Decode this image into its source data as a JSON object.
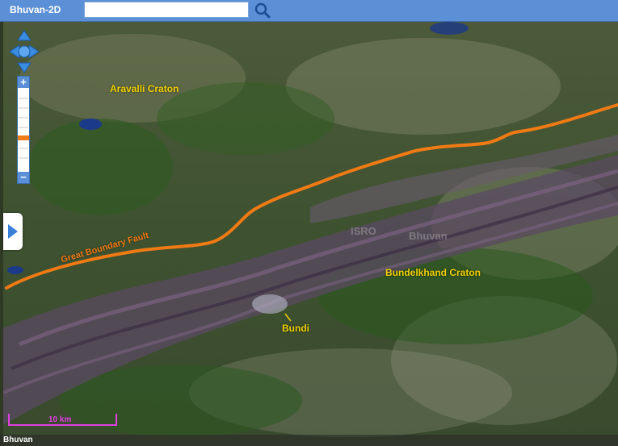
{
  "app": {
    "title": "Bhuvan-2D",
    "footer_brand": "Bhuvan"
  },
  "search": {
    "value": "",
    "placeholder": "",
    "icon": "magnifier-icon"
  },
  "map": {
    "labels": {
      "aravalli": "Aravalli Craton",
      "bundelkhand": "Bundelkhand Craton",
      "bundi": "Bundi",
      "fault": "Great Boundary Fault"
    },
    "watermarks": [
      "Bhuvan",
      "ISRO"
    ],
    "scale": {
      "label": "10 km"
    },
    "colors": {
      "fault_line": "#f07a14",
      "label": "#f0d000",
      "scale": "#e040e0"
    }
  },
  "controls": {
    "pan_icon": "pan-arrows-icon",
    "zoom_in": "+",
    "zoom_out": "−",
    "sidebar_toggle_icon": "triangle-right-icon"
  }
}
